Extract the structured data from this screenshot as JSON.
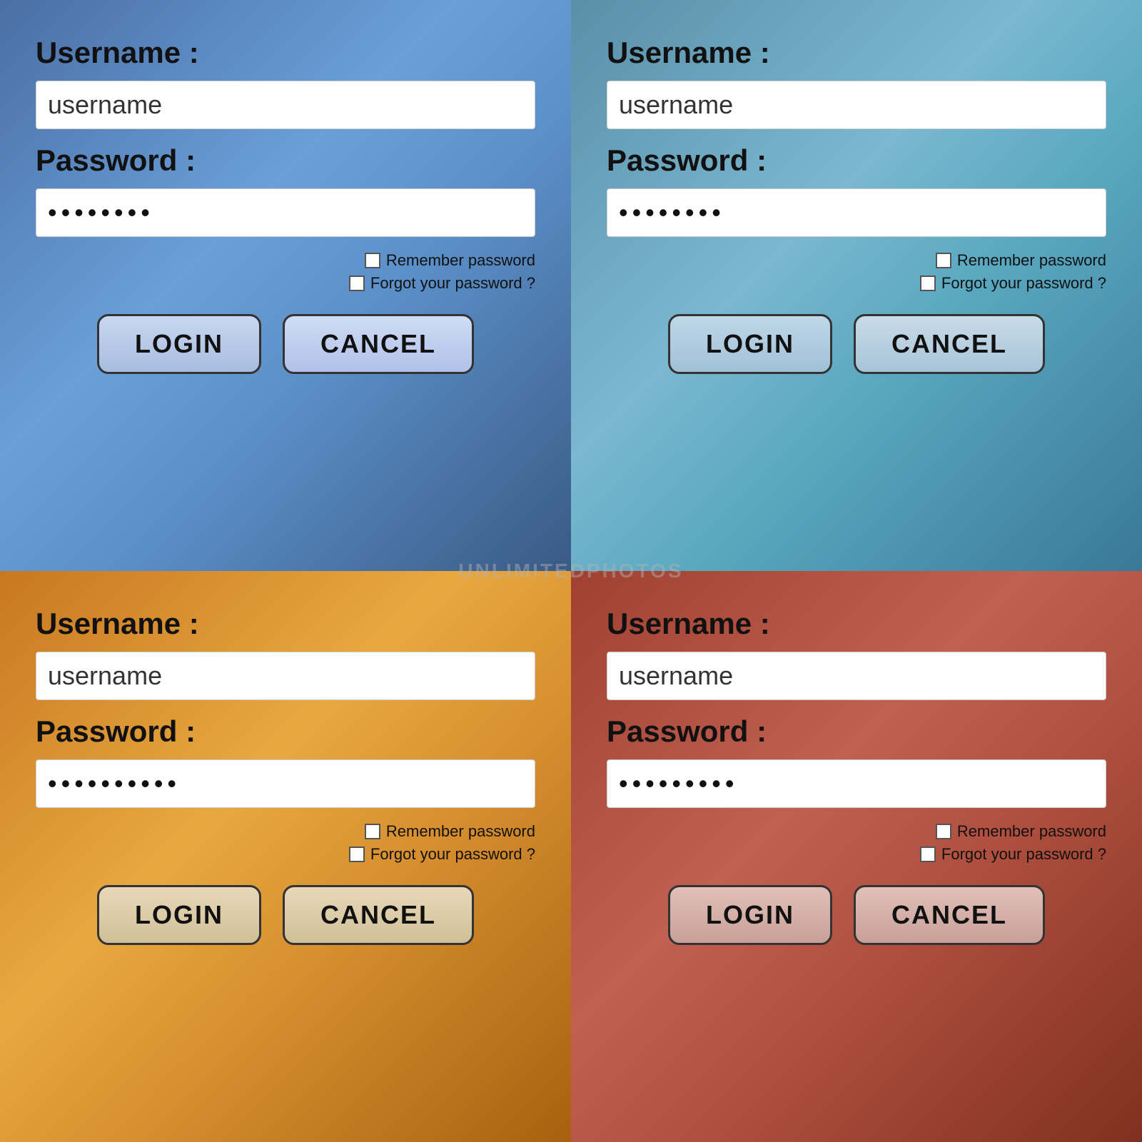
{
  "panels": [
    {
      "id": "top-left",
      "theme": "blue",
      "username_label": "Username :",
      "username_placeholder": "username",
      "password_label": "Password :",
      "password_value": "••••••••",
      "remember_label": "Remember password",
      "forgot_label": "Forgot your password ?",
      "login_label": "LOGIN",
      "cancel_label": "CANCEL"
    },
    {
      "id": "top-right",
      "theme": "teal",
      "username_label": "Username :",
      "username_placeholder": "username",
      "password_label": "Password :",
      "password_value": "••••••••",
      "remember_label": "Remember password",
      "forgot_label": "Forgot your password ?",
      "login_label": "LOGIN",
      "cancel_label": "CANCEL"
    },
    {
      "id": "bottom-left",
      "theme": "orange",
      "username_label": "Username :",
      "username_placeholder": "username",
      "password_label": "Password :",
      "password_value": "••••••••••",
      "remember_label": "Remember password",
      "forgot_label": "Forgot your password ?",
      "login_label": "LOGIN",
      "cancel_label": "CANCEL"
    },
    {
      "id": "bottom-right",
      "theme": "red",
      "username_label": "Username :",
      "username_placeholder": "username",
      "password_label": "Password :",
      "password_value": "•••••••••",
      "remember_label": "Remember password",
      "forgot_label": "Forgot your password ?",
      "login_label": "LOGIN",
      "cancel_label": "CANCEL"
    }
  ],
  "watermark": "UNLIMITEDPHOTOS"
}
